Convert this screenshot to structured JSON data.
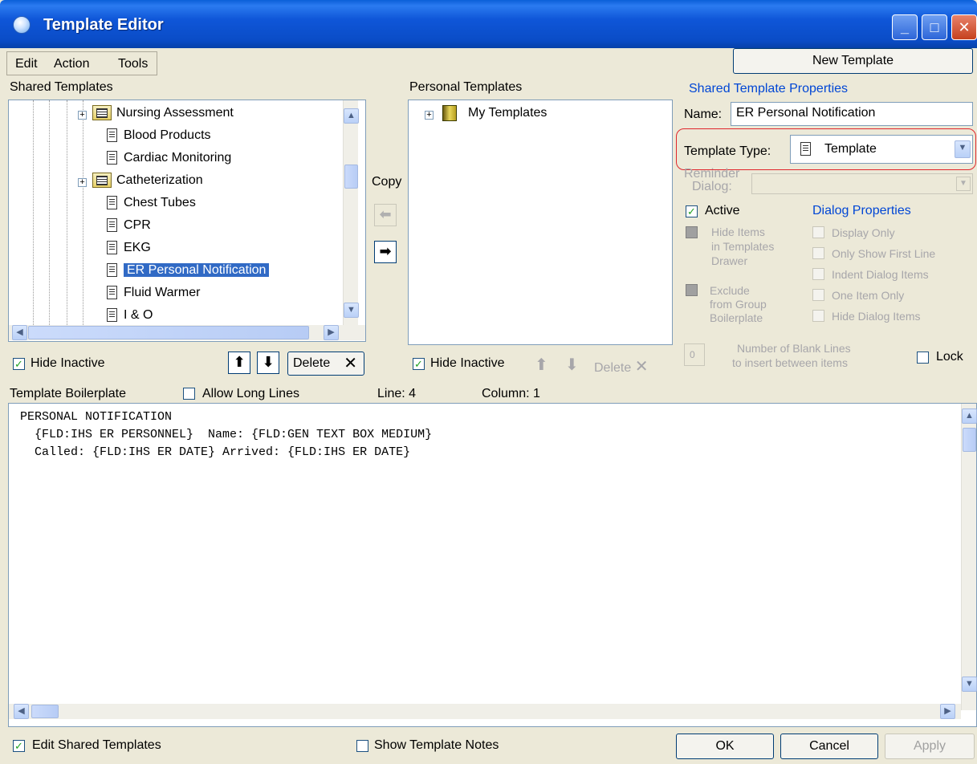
{
  "window": {
    "title": "Template Editor"
  },
  "menu": {
    "items": [
      "Edit",
      "Action",
      "Tools"
    ]
  },
  "new_template_button": "New Template",
  "shared_templates": {
    "header": "Shared Templates",
    "items": [
      {
        "label": "Nursing Assessment",
        "type": "folder"
      },
      {
        "label": "Blood Products",
        "type": "doc"
      },
      {
        "label": "Cardiac Monitoring",
        "type": "doc"
      },
      {
        "label": "Catheterization",
        "type": "folder"
      },
      {
        "label": "Chest Tubes",
        "type": "doc"
      },
      {
        "label": "CPR",
        "type": "doc"
      },
      {
        "label": "EKG",
        "type": "doc"
      },
      {
        "label": "ER Personal Notification",
        "type": "doc",
        "selected": true
      },
      {
        "label": "Fluid Warmer",
        "type": "doc"
      },
      {
        "label": "I & O",
        "type": "doc"
      }
    ],
    "hide_inactive": "Hide Inactive",
    "delete": "Delete"
  },
  "copy_label": "Copy",
  "personal_templates": {
    "header": "Personal Templates",
    "root": "My Templates",
    "hide_inactive": "Hide Inactive",
    "delete": "Delete"
  },
  "properties": {
    "header": "Shared Template Properties",
    "name_label": "Name:",
    "name_value": "ER Personal Notification",
    "type_label": "Template Type:",
    "type_value": "Template",
    "reminder_label_1": "Reminder",
    "reminder_label_2": "Dialog:",
    "active": "Active",
    "hide_items_1": "Hide Items",
    "hide_items_2": "in Templates",
    "hide_items_3": "Drawer",
    "exclude_1": "Exclude",
    "exclude_2": "from Group",
    "exclude_3": "Boilerplate",
    "dialog_props_header": "Dialog Properties",
    "dialog_props": [
      "Display Only",
      "Only Show First Line",
      "Indent Dialog Items",
      "One Item Only",
      "Hide Dialog Items"
    ],
    "blank_lines_value": "0",
    "blank_lines_label_1": "Number of Blank Lines",
    "blank_lines_label_2": "to insert between items",
    "lock": "Lock"
  },
  "boilerplate": {
    "header": "Template Boilerplate",
    "allow_long_lines": "Allow Long Lines",
    "line": "Line: 4",
    "column": "Column: 1",
    "lines": [
      "PERSONAL NOTIFICATION",
      "  {FLD:IHS ER PERSONNEL}  Name: {FLD:GEN TEXT BOX MEDIUM}",
      "  Called: {FLD:IHS ER DATE} Arrived: {FLD:IHS ER DATE}"
    ]
  },
  "footer": {
    "edit_shared": "Edit Shared Templates",
    "show_notes": "Show Template Notes",
    "ok": "OK",
    "cancel": "Cancel",
    "apply": "Apply"
  },
  "colors": {
    "titlebar": "#0a4cc6",
    "selection": "#316ac5",
    "highlight_outline": "#e0262c",
    "link_blue": "#0046d5"
  }
}
